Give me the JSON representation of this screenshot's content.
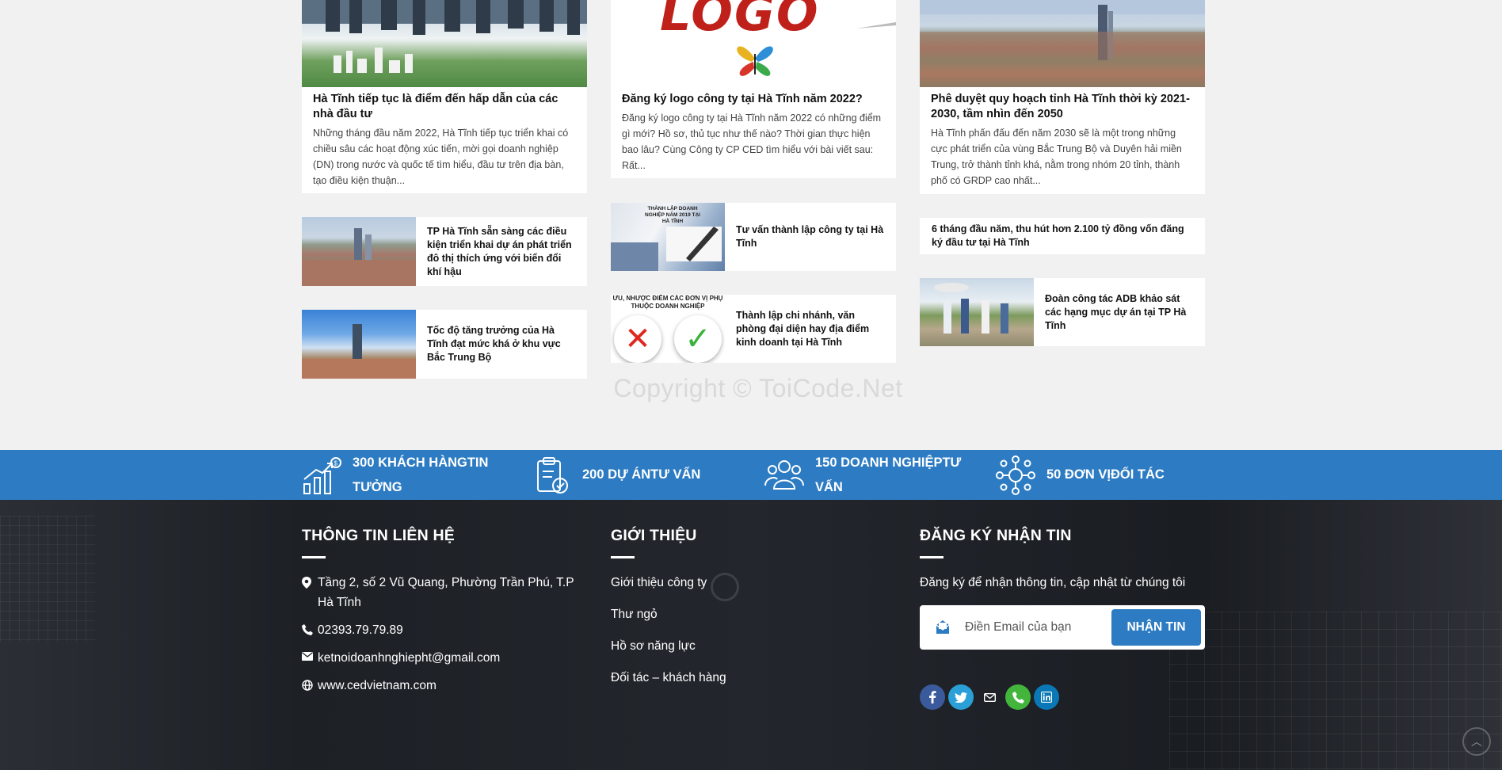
{
  "news": {
    "features": [
      {
        "title": "Hà Tĩnh tiếp tục là điểm đến hấp dẫn của các nhà đầu tư",
        "excerpt": "Những tháng đầu năm 2022, Hà Tĩnh tiếp tục triển khai có chiều sâu các hoạt động xúc tiến, mời gọi doanh nghiệp (DN) trong nước và quốc tế tìm hiểu, đầu tư trên địa bàn, tạo điều kiện thuận..."
      },
      {
        "title": "Đăng ký logo công ty tại Hà Tĩnh năm 2022?",
        "excerpt": "Đăng ký logo công ty tại Hà Tĩnh năm 2022  có những điểm gì mới? Hồ sơ, thủ tục như thế nào? Thời gian thực hiện bao lâu? Cùng Công ty CP CED tìm hiểu với bài viết sau: Rất...",
        "image_text": "LOGO"
      },
      {
        "title": "Phê duyệt quy hoạch tỉnh Hà Tĩnh thời kỳ 2021-2030, tầm nhìn đến 2050",
        "excerpt": "Hà Tĩnh phấn đấu đến năm 2030 sẽ là một trong những cực phát triển của vùng Bắc Trung Bộ và Duyên hải miền Trung, trở thành tỉnh khá, nằm trong nhóm 20 tỉnh, thành phố có GRDP cao nhất..."
      }
    ],
    "small": [
      {
        "title": "TP Hà Tĩnh sẵn sàng các điều kiện triển khai dự án phát triển đô thị thích ứng với biến đổi khí hậu"
      },
      {
        "title": "Tốc độ tăng trưởng của Hà Tĩnh đạt mức khá ở khu vực Bắc Trung Bộ"
      },
      {
        "title": "Tư vấn thành lập công ty tại Hà Tĩnh",
        "image_text": "THÀNH LẬP DOANH NGHIỆP NĂM 2019 TẠI HÀ TĨNH"
      },
      {
        "title": "Thành lập chi nhánh, văn phòng đại diện hay địa điểm kinh doanh tại Hà Tĩnh",
        "image_text": "ƯU, NHƯỢC ĐIỂM CÁC ĐƠN VỊ PHỤ THUỘC DOANH NGHIỆP"
      },
      {
        "title": "6 tháng đầu năm, thu hút hơn 2.100 tỷ đồng vốn đăng ký đầu tư tại Hà Tĩnh"
      },
      {
        "title": "Đoàn công tác ADB khảo sát các hạng mục dự án tại TP Hà Tĩnh"
      }
    ],
    "watermark": "Copyright © ToiCode.Net"
  },
  "stats": [
    {
      "label": "300 KHÁCH HÀNGTIN TƯỞNG",
      "icon": "growth-chart-icon"
    },
    {
      "label": "200 DỰ ÁNTƯ VẤN",
      "icon": "clipboard-check-icon"
    },
    {
      "label": "150 DOANH NGHIỆPTƯ VẤN",
      "icon": "people-group-icon"
    },
    {
      "label": "50 ĐƠN VỊĐỐI TÁC",
      "icon": "network-icon"
    }
  ],
  "footer": {
    "contact": {
      "heading": "THÔNG TIN LIÊN HỆ",
      "address": "Tầng 2, số 2 Vũ Quang, Phường Trần Phú, T.P Hà Tĩnh",
      "phone": "02393.79.79.89",
      "email": "ketnoidoanhnghiepht@gmail.com",
      "website": "www.cedvietnam.com"
    },
    "about": {
      "heading": "GIỚI THIỆU",
      "links": [
        "Giới thiệu công ty",
        "Thư ngỏ",
        "Hồ sơ năng lực",
        "Đối tác – khách hàng"
      ]
    },
    "newsletter": {
      "heading": "ĐĂNG KÝ NHẬN TIN",
      "description": "Đăng ký để nhận thông tin, cập nhật từ chúng tôi",
      "placeholder": "Điền Email của bạn",
      "button": "NHẬN TIN"
    },
    "social": [
      "facebook-icon",
      "twitter-icon",
      "email-icon",
      "phone-icon",
      "linkedin-icon"
    ]
  },
  "colors": {
    "primary": "#2d7cc3",
    "page_bg": "#f1f1f1",
    "footer_bg": "#1f2328"
  }
}
